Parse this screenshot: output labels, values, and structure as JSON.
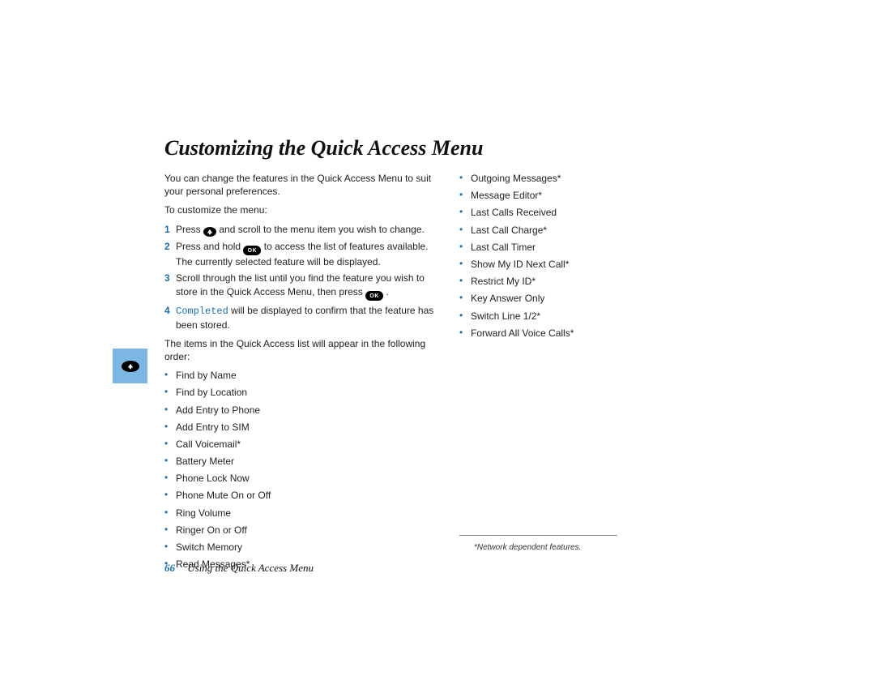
{
  "title": "Customizing the Quick Access Menu",
  "intro1": "You can change the features in the Quick Access Menu to suit your personal preferences.",
  "intro2": "To customize the menu:",
  "steps": {
    "s1_a": "Press ",
    "s1_b": " and scroll to the menu item you wish to change.",
    "s2_a": "Press and hold ",
    "s2_b": " to access the list of features available. The currently selected feature will be displayed.",
    "s3_a": "Scroll through the list until you find the feature you wish to store in the Quick Access Menu, then press ",
    "s3_b": ".",
    "s4_word": "Completed",
    "s4_rest": " will be displayed to confirm that the feature has been stored.",
    "n1": "1",
    "n2": "2",
    "n3": "3",
    "n4": "4"
  },
  "order_intro": "The items in the Quick Access list will appear in the following order:",
  "left_items": [
    "Find by Name",
    "Find by Location",
    "Add Entry to Phone",
    "Add Entry to SIM",
    "Call Voicemail*",
    "Battery Meter",
    "Phone Lock Now",
    "Phone Mute On or Off",
    "Ring Volume",
    "Ringer On or Off",
    "Switch Memory",
    "Read Messages*"
  ],
  "right_items": [
    "Outgoing Messages*",
    "Message Editor*",
    "Last Calls Received",
    "Last Call Charge*",
    "Last Call Timer",
    "Show My ID Next Call*",
    "Restrict My ID*",
    "Key Answer Only",
    "Switch Line 1/2*",
    "Forward All Voice Calls*"
  ],
  "ok_label": "OK",
  "footnote": "*Network dependent features.",
  "footer": {
    "page": "66",
    "section": "Using the Quick Access Menu"
  }
}
